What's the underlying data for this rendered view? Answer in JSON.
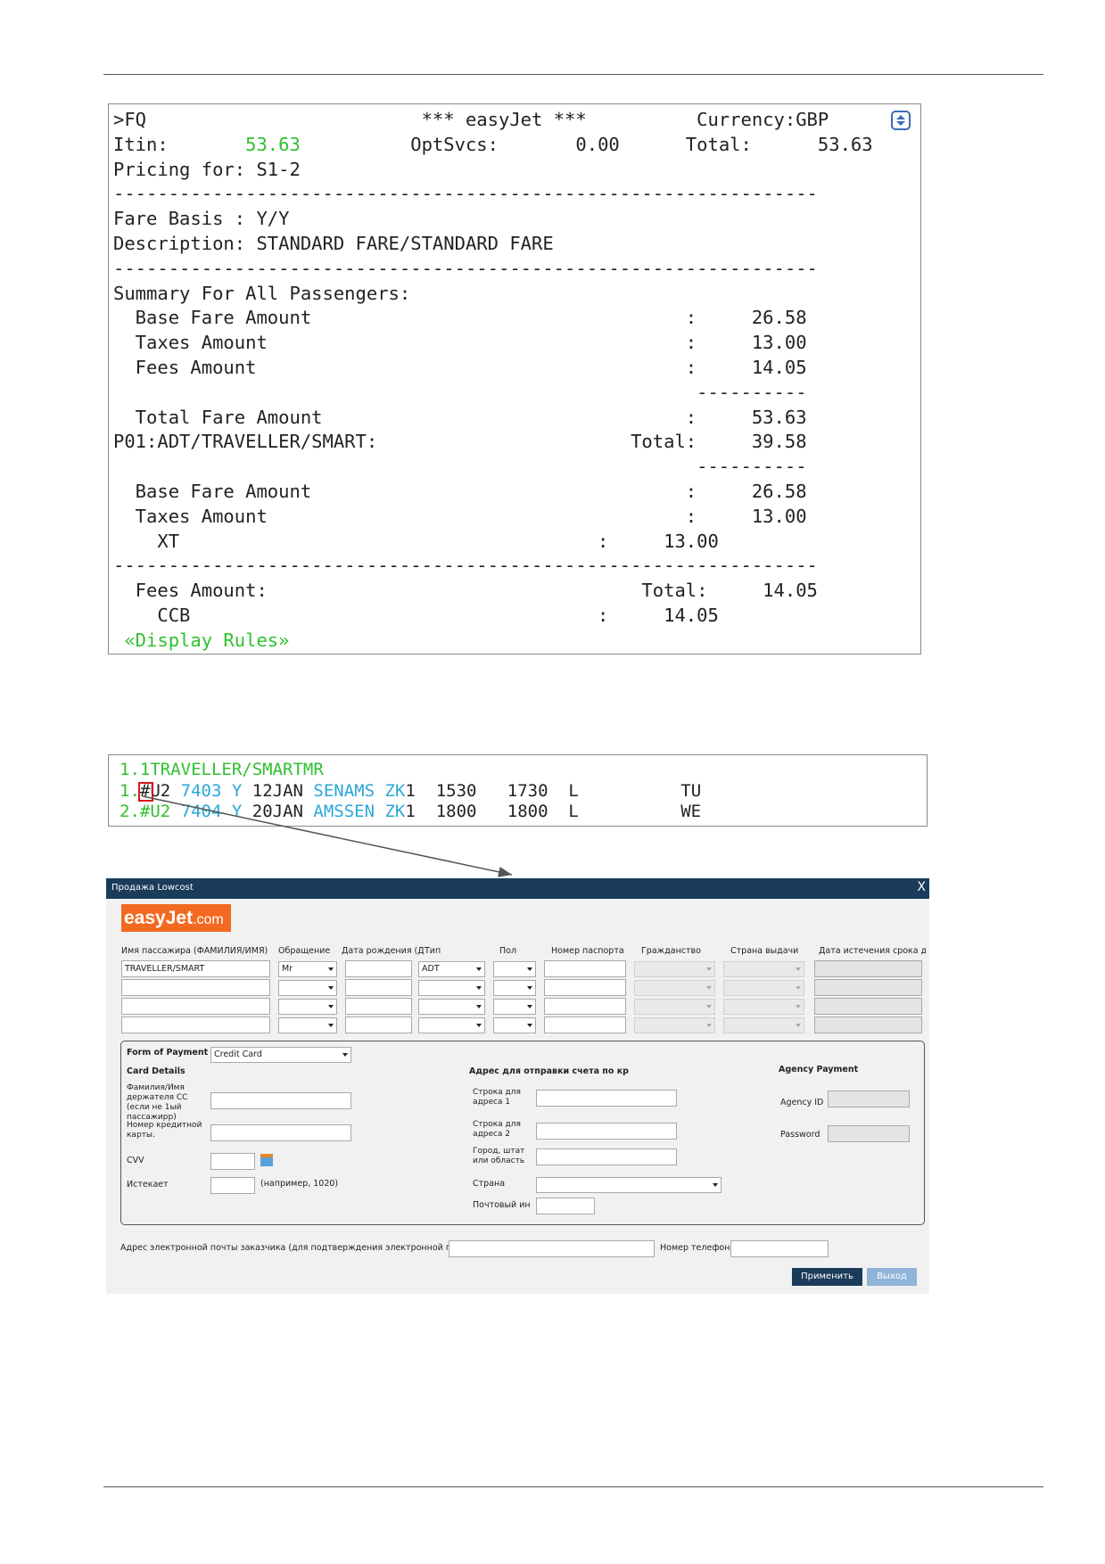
{
  "terminal": {
    "lines": [
      [
        {
          "t": ">FQ                         *** easyJet ***          Currency:GBP"
        }
      ],
      [
        {
          "t": "Itin:       "
        },
        {
          "t": "53.63",
          "g": true
        },
        {
          "t": "          OptSvcs:       0.00      Total:      53.63"
        }
      ],
      [
        {
          "t": "Pricing for: S1-2"
        }
      ],
      [
        {
          "t": "----------------------------------------------------------------"
        }
      ],
      [
        {
          "t": "Fare Basis : Y/Y"
        }
      ],
      [
        {
          "t": "Description: STANDARD FARE/STANDARD FARE"
        }
      ],
      [
        {
          "t": "----------------------------------------------------------------"
        }
      ],
      [
        {
          "t": "Summary For All Passengers:"
        }
      ],
      [
        {
          "t": "  Base Fare Amount                                  :     26.58"
        }
      ],
      [
        {
          "t": "  Taxes Amount                                      :     13.00"
        }
      ],
      [
        {
          "t": "  Fees Amount                                       :     14.05"
        }
      ],
      [
        {
          "t": "                                                     ----------"
        }
      ],
      [
        {
          "t": "  Total Fare Amount                                 :     53.63"
        }
      ],
      [
        {
          "t": "P01:ADT/TRAVELLER/SMART:                       Total:     39.58"
        }
      ],
      [
        {
          "t": "                                                     ----------"
        }
      ],
      [
        {
          "t": "  Base Fare Amount                                  :     26.58"
        }
      ],
      [
        {
          "t": "  Taxes Amount                                      :     13.00"
        }
      ],
      [
        {
          "t": "    XT                                      :     13.00"
        }
      ],
      [
        {
          "t": "----------------------------------------------------------------"
        }
      ],
      [
        {
          "t": "  Fees Amount:                                  Total:     14.05"
        }
      ],
      [
        {
          "t": "    CCB                                     :     14.05"
        }
      ],
      [
        {
          "t": " «Display Rules»",
          "g": true
        }
      ]
    ]
  },
  "pnr": {
    "lines": [
      [
        {
          "t": "1.1TRAVELLER/SMARTMR",
          "c": "g"
        }
      ],
      [
        {
          "t": "1.",
          "c": "g"
        },
        {
          "t": "#"
        },
        {
          "t": "U2 "
        },
        {
          "t": "7403",
          "c": "b"
        },
        {
          "t": " "
        },
        {
          "t": "Y",
          "c": "b"
        },
        {
          "t": " 12JAN "
        },
        {
          "t": "SENAMS",
          "c": "b"
        },
        {
          "t": " "
        },
        {
          "t": "ZK",
          "c": "b"
        },
        {
          "t": "1  1530   1730  L          TU"
        }
      ],
      [
        {
          "t": "2.#U2 ",
          "c": "g"
        },
        {
          "t": "7404",
          "c": "b"
        },
        {
          "t": " "
        },
        {
          "t": "Y",
          "c": "b"
        },
        {
          "t": " 20JAN "
        },
        {
          "t": "AMSSEN",
          "c": "b"
        },
        {
          "t": " "
        },
        {
          "t": "ZK",
          "c": "b"
        },
        {
          "t": "1  1800   1800  L          WE"
        }
      ]
    ]
  },
  "dialog": {
    "title": "Продажа Lowcost",
    "close": "X",
    "logo_main": "easyJet",
    "logo_suffix": ".com",
    "headers": {
      "name": "Имя пассажира (ФАМИЛИЯ/ИМЯ)",
      "title": "Обращение",
      "dob": "Дата рождения (Д",
      "type": "Тип",
      "gender": "Пол",
      "passport": "Номер паспорта",
      "citizenship": "Гражданство",
      "issuing_country": "Страна выдачи",
      "expiry": "Дата истечения срока де"
    },
    "passengers": [
      {
        "name": "TRAVELLER/SMART",
        "title": "Mr",
        "type": "ADT"
      },
      {
        "name": "",
        "title": "",
        "type": ""
      },
      {
        "name": "",
        "title": "",
        "type": ""
      },
      {
        "name": "",
        "title": "",
        "type": ""
      }
    ],
    "payment": {
      "form_label": "Form of Payment",
      "form_value": "Credit Card",
      "card_details": "Card Details",
      "holder_label": "Фамилия/Имя держателя СС (если не 1ый пассажирр)",
      "card_number_label": "Номер кредитной карты.",
      "cvv_label": "CVV",
      "expires_label": "Истекает",
      "expires_hint": "(например, 1020)",
      "billing_header": "Адрес для отправки счета по кр",
      "address1_label": "Строка для адреса 1",
      "address2_label": "Строка для адреса 2",
      "city_label": "Город, штат или область",
      "country_label": "Страна",
      "postal_label": "Почтовый инд",
      "agency_header": "Agency Payment",
      "agency_id_label": "Agency ID",
      "password_label": "Password"
    },
    "email_label": "Адрес электронной почты заказчика (для подтверждения электронной почты)",
    "phone_label": "Номер телефона",
    "apply": "Применить",
    "exit": "Выход",
    "colors": {
      "titlebar": "#1b3b5a",
      "apply": "#1b3b5a",
      "exit": "#8fb4d8",
      "logo": "#f26a21"
    }
  }
}
